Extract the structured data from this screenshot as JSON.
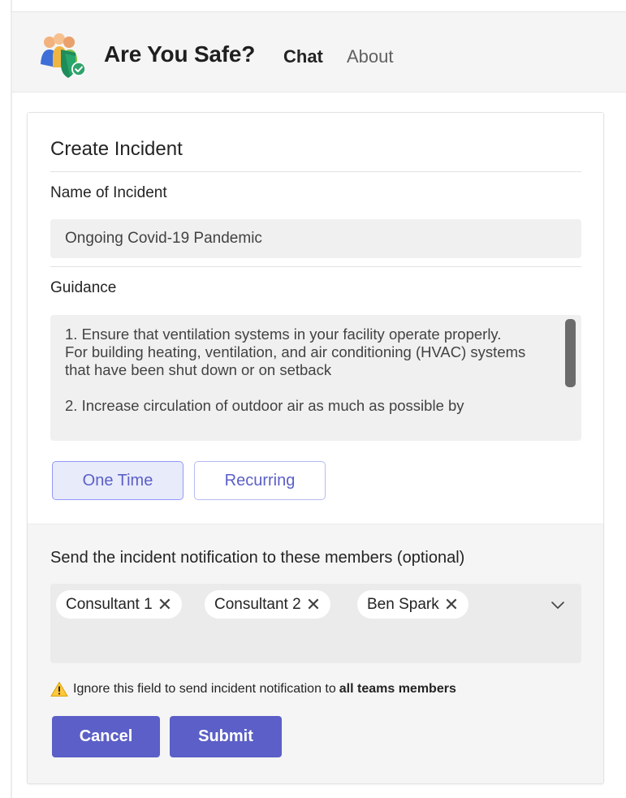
{
  "header": {
    "app_title": "Are You Safe?",
    "tabs": [
      {
        "label": "Chat",
        "active": true
      },
      {
        "label": "About",
        "active": false
      }
    ]
  },
  "form": {
    "title": "Create Incident",
    "name_label": "Name of Incident",
    "name_value": "Ongoing Covid-19 Pandemic",
    "guidance_label": "Guidance",
    "guidance_text": "1. Ensure that ventilation systems in your facility operate properly. For building heating, ventilation, and air conditioning (HVAC) systems that have been shut down or on setback\n\n2. Increase circulation of outdoor air as much as possible by",
    "frequency_options": [
      {
        "label": "One Time",
        "selected": true
      },
      {
        "label": "Recurring",
        "selected": false
      }
    ],
    "members_label": "Send the incident notification to these members (optional)",
    "members": [
      "Consultant 1",
      "Consultant 2",
      "Ben Spark"
    ],
    "remove_glyph": "✕",
    "warning_text": "Ignore this field to send incident notification to",
    "warning_emphasis": "all teams members",
    "cancel_label": "Cancel",
    "submit_label": "Submit"
  },
  "colors": {
    "accent": "#5b5fc7",
    "selected_bg": "#e8ebfa",
    "warning": "#ffc83d"
  },
  "icons": {
    "app_logo": "team-shield-check-icon",
    "remove": "close-icon",
    "dropdown": "chevron-down-icon",
    "warning": "warning-triangle-icon"
  }
}
